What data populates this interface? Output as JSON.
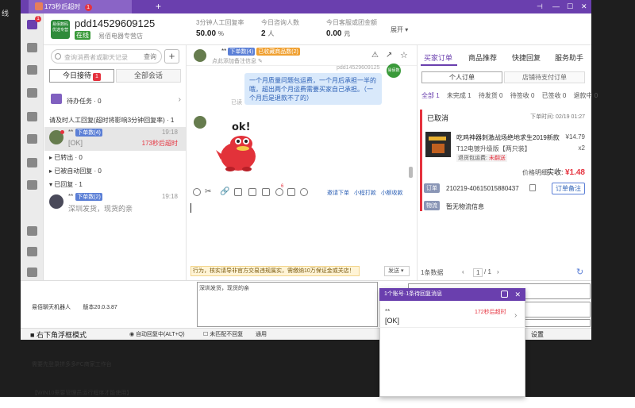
{
  "window": {
    "tab_title": "173秒后超时",
    "tab_badge": "1",
    "new_tab": "+",
    "controls": {
      "pin": "⊣",
      "minimize": "—",
      "maximize": "☐",
      "close": "✕"
    }
  },
  "desktop": {
    "left_text": "线"
  },
  "header": {
    "shop_logo": "易佰数码 优选专营",
    "shop_name": "pdd14529609125",
    "status": "在线",
    "subtitle": "易佰电器专营店",
    "stats": [
      {
        "label": "3分钟人工回复率",
        "value": "50.00",
        "unit": "%"
      },
      {
        "label": "今日咨询人数",
        "value": "2",
        "unit": "人"
      },
      {
        "label": "今日客服或团金额",
        "value": "0.00",
        "unit": "元"
      }
    ],
    "expand": "展开"
  },
  "sidebar": {
    "badge": "1"
  },
  "left_panel": {
    "search_placeholder": "查询消费者或聊天记录",
    "search_button": "查询",
    "add_button": "+",
    "tab_waiting": "今日接待",
    "tab_waiting_badge": "1",
    "tab_all": "全部会话",
    "todo": "待办任务 · 0",
    "todo_chevron": "›",
    "section_pending": "请及时人工回复(超时将影响3分钟回复率) · 1",
    "section_transferred": "已转出 · 0",
    "section_auto": "已被自动回复 · 0",
    "section_replied": "已回复 · 1",
    "items": [
      {
        "name": "**",
        "tag": "下单数(4)",
        "time": "19:18",
        "msg": "[OK]",
        "overtime": "173秒后超时"
      },
      {
        "name": "**",
        "tag": "下单数(2)",
        "time": "19:18",
        "msg": "深圳发货，现货的亲",
        "overtime": ""
      }
    ]
  },
  "chat": {
    "customer_name": "**",
    "tag_orders": "下单数(4)",
    "tag_refund": "已收藏商品数(2)",
    "subtitle": "点此添加备注信息",
    "timestamp": "pdd14529609125",
    "bubble_text": "一个月质量问题包运费，一个月后承担一半的哦，超出两个月运费需要买家自己承担。（一个月后是退款不了的）",
    "read_status": "已读",
    "shop_avatar": "易佰数码",
    "sticker_text": "ok!",
    "links": {
      "invite": "邀请下单",
      "query": "小程打款",
      "collect": "小额收款"
    },
    "toolbar_badge": "6",
    "warning": "行为，核实请导非官方交易违规属实，需缴纳10万保证金或关店！",
    "send_button": "发送"
  },
  "right_panel": {
    "tabs": [
      "买家订单",
      "商品推荐",
      "快捷回复",
      "服务助手"
    ],
    "sub_personal": "个人订单",
    "sub_shop": "店铺待支付订单",
    "filters": [
      "全部 1",
      "未完成 1",
      "待发货 0",
      "待签收 0",
      "已签收 0",
      "退款中 0"
    ],
    "order": {
      "status": "已取消",
      "time": "下单时间: 02/19 01:27",
      "product_name": "吃鸡神器刺激战场绝地求生2019新款T1...",
      "price": "¥14.79",
      "sku": "T12电镀升级版【两只装】",
      "qty": "x2",
      "return_label": "退货包运费: ",
      "return_value": "未翻送",
      "price_detail": "价格明细",
      "paid_label": "实收: ",
      "paid_value": "¥1.48",
      "order_label": "订单",
      "order_id": "210219-406150158804​37",
      "note_button": "订单备注",
      "logistics_label": "物流",
      "logistics": "暂无物流信息"
    },
    "pager_count": "1条数据",
    "pager_page": "1",
    "pager_total": "/ 1",
    "refresh": "↻"
  },
  "bottom": {
    "robot_lines": [
      "易佰聊天机器人        版本20.0.3.87",
      "- 多多商家工作台 模拟鼠标键盘自动回复",
      "需要先登录拼多多PC商家工作台",
      "【WIN10需要管理员运行程序才能使用】"
    ],
    "textarea_text": "深圳发货，现货的亲",
    "float_mode": "右下角浮框模式",
    "auto_reply": "自动回复中(ALT+Q)",
    "no_match": "未匹配不回复",
    "common": "通用",
    "settings": "设置"
  },
  "popup": {
    "title": "1个账号·1条待回复消息",
    "close": "✕",
    "name": "**",
    "overtime": "172秒后超时",
    "msg": "[OK]",
    "chevron": "›"
  },
  "colors": {
    "brand": "#6a3fae",
    "alert": "#e5323e",
    "link": "#2b5fb5",
    "bubble": "#d9e9fb"
  }
}
